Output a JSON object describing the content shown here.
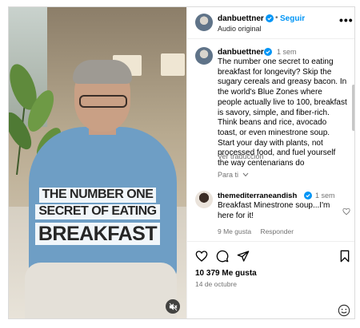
{
  "video": {
    "caption_line1": "THE NUMBER ONE",
    "caption_line2": "SECRET OF EATING",
    "caption_line3": "BREAKFAST"
  },
  "header": {
    "username": "danbuettner",
    "separator": "•",
    "follow_label": "Seguir",
    "audio_label": "Audio original",
    "more_label": "•••"
  },
  "post": {
    "username": "danbuettner",
    "time": "1 sem",
    "caption": "The number one secret to eating breakfast for longevity? Skip the sugary cereals and greasy bacon. In the world's Blue Zones where people actually live to 100, breakfast is savory, simple, and fiber-rich. Think beans and rice, avocado toast, or even minestrone soup. Start your day with plants, not processed food, and fuel yourself the way centenarians do",
    "translate_label": "Ver traducción",
    "for_you_label": "Para ti"
  },
  "comment": {
    "username": "themediterraneandish",
    "time": "1 sem",
    "text": "Breakfast Minestrone soup...I'm here for it!",
    "likes": "9 Me gusta",
    "reply_label": "Responder"
  },
  "footer": {
    "likes": "10 379 Me gusta",
    "date": "14 de octubre"
  },
  "colors": {
    "accent": "#0095f6",
    "muted": "#737373",
    "verified": "#0095f6"
  }
}
